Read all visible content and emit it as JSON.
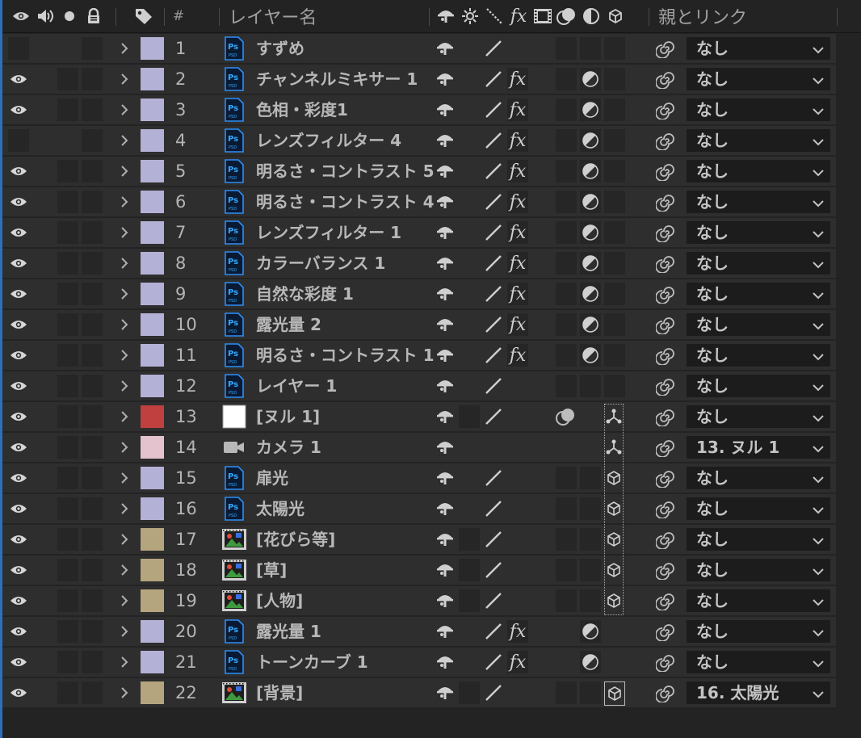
{
  "columns": {
    "number": "#",
    "layer_name": "レイヤー名",
    "parent_link": "親とリンク"
  },
  "colors": {
    "lavender": "#b4b1d6",
    "red": "#c0403f",
    "pink": "#e4c3cf",
    "tan": "#b5a57e",
    "accent": "#2d6fb8"
  },
  "layers": [
    {
      "num": "1",
      "name": "すずめ",
      "parent": "なし",
      "eye": false,
      "label": "lavender",
      "type": "psd",
      "fx": false,
      "adj": false,
      "box3d": "empty"
    },
    {
      "num": "2",
      "name": "チャンネルミキサー 1",
      "parent": "なし",
      "eye": true,
      "label": "lavender",
      "type": "psd",
      "fx": true,
      "adj": true,
      "box3d": "empty"
    },
    {
      "num": "3",
      "name": "色相・彩度1",
      "parent": "なし",
      "eye": true,
      "label": "lavender",
      "type": "psd",
      "fx": true,
      "adj": true,
      "box3d": "empty"
    },
    {
      "num": "4",
      "name": "レンズフィルター 4",
      "parent": "なし",
      "eye": false,
      "label": "lavender",
      "type": "psd",
      "fx": true,
      "adj": true,
      "box3d": "empty"
    },
    {
      "num": "5",
      "name": "明るさ・コントラスト 5",
      "parent": "なし",
      "eye": true,
      "label": "lavender",
      "type": "psd",
      "fx": true,
      "adj": true,
      "box3d": "empty"
    },
    {
      "num": "6",
      "name": "明るさ・コントラスト 4",
      "parent": "なし",
      "eye": true,
      "label": "lavender",
      "type": "psd",
      "fx": true,
      "adj": true,
      "box3d": "empty"
    },
    {
      "num": "7",
      "name": "レンズフィルター 1",
      "parent": "なし",
      "eye": true,
      "label": "lavender",
      "type": "psd",
      "fx": true,
      "adj": true,
      "box3d": "empty"
    },
    {
      "num": "8",
      "name": "カラーバランス 1",
      "parent": "なし",
      "eye": true,
      "label": "lavender",
      "type": "psd",
      "fx": true,
      "adj": true,
      "box3d": "empty"
    },
    {
      "num": "9",
      "name": "自然な彩度 1",
      "parent": "なし",
      "eye": true,
      "label": "lavender",
      "type": "psd",
      "fx": true,
      "adj": true,
      "box3d": "empty"
    },
    {
      "num": "10",
      "name": "露光量 2",
      "parent": "なし",
      "eye": true,
      "label": "lavender",
      "type": "psd",
      "fx": true,
      "adj": true,
      "box3d": "empty"
    },
    {
      "num": "11",
      "name": "明るさ・コントラスト 1",
      "parent": "なし",
      "eye": true,
      "label": "lavender",
      "type": "psd",
      "fx": true,
      "adj": true,
      "box3d": "empty"
    },
    {
      "num": "12",
      "name": "レイヤー 1",
      "parent": "なし",
      "eye": true,
      "label": "lavender",
      "type": "psd",
      "fx": false,
      "adj": false,
      "box3d": "empty"
    },
    {
      "num": "13",
      "name": "[ヌル 1]",
      "parent": "なし",
      "eye": true,
      "label": "red",
      "type": "null",
      "fx": false,
      "adj": false,
      "box3d": "axis"
    },
    {
      "num": "14",
      "name": "カメラ 1",
      "parent": "13. ヌル 1",
      "eye": true,
      "label": "pink",
      "type": "camera",
      "fx": false,
      "adj": false,
      "box3d": "axis"
    },
    {
      "num": "15",
      "name": "扉光",
      "parent": "なし",
      "eye": true,
      "label": "lavender",
      "type": "psd",
      "fx": false,
      "adj": false,
      "box3d": "cube"
    },
    {
      "num": "16",
      "name": "太陽光",
      "parent": "なし",
      "eye": true,
      "label": "lavender",
      "type": "psd",
      "fx": false,
      "adj": false,
      "box3d": "cube"
    },
    {
      "num": "17",
      "name": "[花びら等]",
      "parent": "なし",
      "eye": true,
      "label": "tan",
      "type": "footage",
      "fx": false,
      "adj": false,
      "box3d": "cube"
    },
    {
      "num": "18",
      "name": "[草]",
      "parent": "なし",
      "eye": true,
      "label": "tan",
      "type": "footage",
      "fx": false,
      "adj": false,
      "box3d": "cube"
    },
    {
      "num": "19",
      "name": "[人物]",
      "parent": "なし",
      "eye": true,
      "label": "tan",
      "type": "footage",
      "fx": false,
      "adj": false,
      "box3d": "cube"
    },
    {
      "num": "20",
      "name": "露光量 1",
      "parent": "なし",
      "eye": true,
      "label": "lavender",
      "type": "psd",
      "fx": true,
      "adj": true,
      "box3d": "none"
    },
    {
      "num": "21",
      "name": "トーンカーブ 1",
      "parent": "なし",
      "eye": true,
      "label": "lavender",
      "type": "psd",
      "fx": true,
      "adj": true,
      "box3d": "none"
    },
    {
      "num": "22",
      "name": "[背景]",
      "parent": "16. 太陽光",
      "eye": true,
      "label": "tan",
      "type": "footage",
      "fx": false,
      "adj": false,
      "box3d": "cube"
    }
  ]
}
